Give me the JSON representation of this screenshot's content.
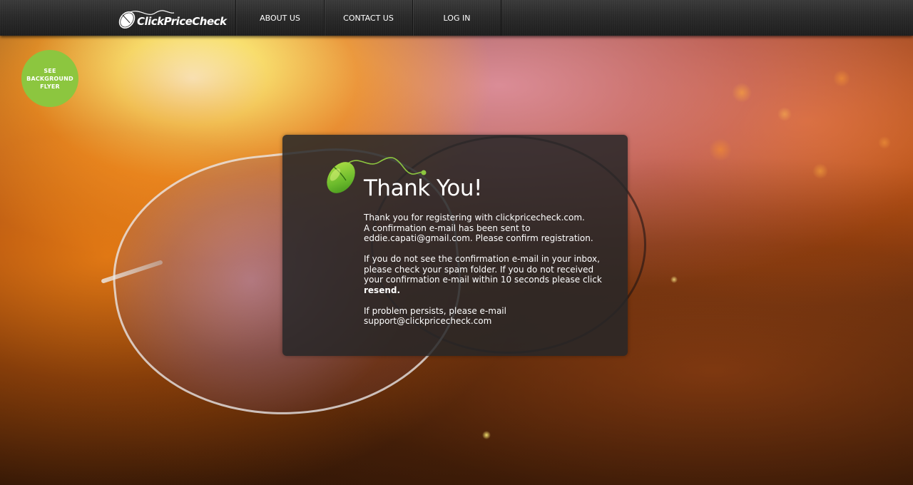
{
  "brand": {
    "name": "ClickPriceCheck"
  },
  "nav": {
    "items": [
      {
        "label": "ABOUT US"
      },
      {
        "label": "CONTACT US"
      },
      {
        "label": "LOG IN"
      }
    ]
  },
  "badge": {
    "line1": "SEE",
    "line2": "BACKGROUND",
    "line3": "FLYER",
    "color": "#8cc63f"
  },
  "card": {
    "title": "Thank You!",
    "p1": {
      "l1": "Thank you for registering with clickpricecheck.com.",
      "l2": "A confirmation e-mail has been sent to",
      "l3": "eddie.capati@gmail.com. Please confirm registration."
    },
    "p2": {
      "l1": "If you do not see the confirmation e-mail in your inbox,",
      "l2": "please check your spam folder. If you do not received",
      "l3": "your confirmation e-mail within 10 seconds please click",
      "link": "resend."
    },
    "p3": {
      "l1": "If problem persists, please e-mail",
      "l2": "support@clickpricecheck.com"
    }
  },
  "colors": {
    "accent_green": "#8cc63f",
    "topbar": "#2a2a2a",
    "card_bg": "#262628"
  },
  "icons": [
    "computer-mouse-logo-icon"
  ]
}
